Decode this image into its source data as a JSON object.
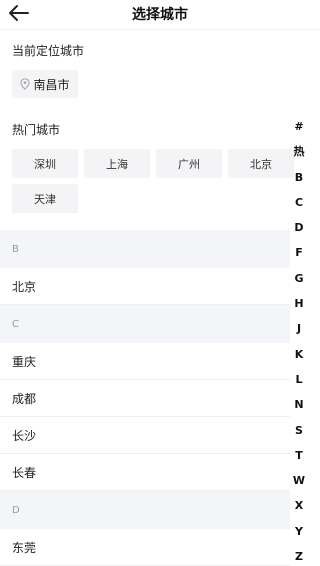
{
  "header": {
    "title": "选择城市"
  },
  "current": {
    "label": "当前定位城市",
    "city": "南昌市"
  },
  "hot": {
    "label": "热门城市",
    "cities": [
      "深圳",
      "上海",
      "广州",
      "北京",
      "天津"
    ]
  },
  "groups": [
    {
      "letter": "B",
      "cities": [
        "北京"
      ]
    },
    {
      "letter": "C",
      "cities": [
        "重庆",
        "成都",
        "长沙",
        "长春"
      ]
    },
    {
      "letter": "D",
      "cities": [
        "东莞"
      ]
    }
  ],
  "index": [
    "#",
    "热",
    "B",
    "C",
    "D",
    "F",
    "G",
    "H",
    "J",
    "K",
    "L",
    "N",
    "S",
    "T",
    "W",
    "X",
    "Y",
    "Z"
  ]
}
